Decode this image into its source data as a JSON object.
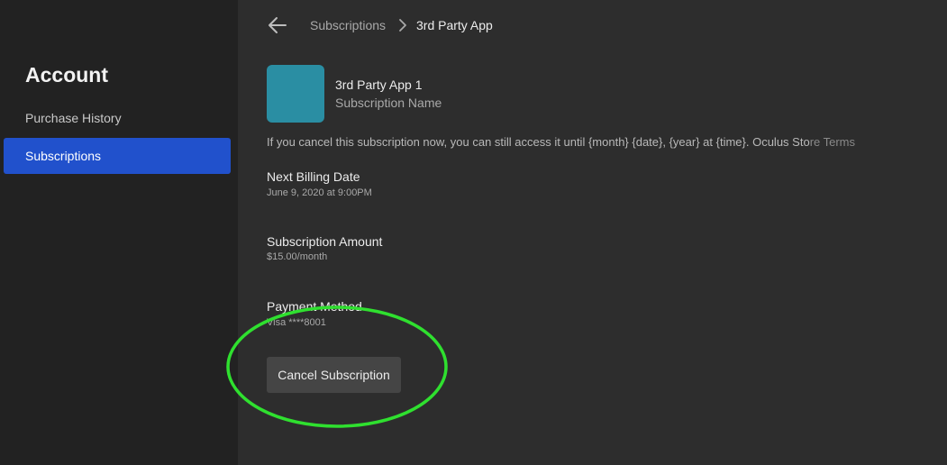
{
  "sidebar": {
    "title": "Account",
    "items": [
      {
        "label": "Purchase History",
        "active": false
      },
      {
        "label": "Subscriptions",
        "active": true
      }
    ]
  },
  "header": {
    "back_icon": "arrow-left-icon",
    "breadcrumb": {
      "parent": "Subscriptions",
      "separator_icon": "chevron-right-icon",
      "current": "3rd Party App"
    }
  },
  "subscription": {
    "app_tile_color": "#2a8ea3",
    "app_name": "3rd Party App 1",
    "subscription_name": "Subscription Name",
    "notice_text": "If you cancel this subscription now, you can still access it until {month} {date}, {year} at {time}. ",
    "terms_link_start": "Oculus Sto",
    "terms_link_faded": "re Terms",
    "next_billing": {
      "label": "Next Billing Date",
      "value": "June 9, 2020 at 9:00PM"
    },
    "amount": {
      "label": "Subscription Amount",
      "value": "$15.00/month"
    },
    "payment": {
      "label": "Payment Method",
      "value": "Visa ****8001"
    },
    "cancel_label": "Cancel Subscription"
  },
  "colors": {
    "accent": "#2151cc",
    "highlight_ring": "#2fe02f",
    "sidebar_bg": "#222222",
    "main_bg": "#2d2d2d"
  }
}
